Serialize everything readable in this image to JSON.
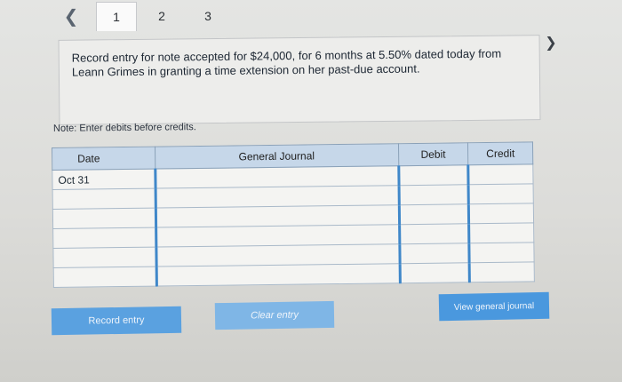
{
  "navigation": {
    "back_icon": "chevron-left-icon",
    "tabs": [
      {
        "label": "1",
        "active": true
      },
      {
        "label": "2",
        "active": false
      },
      {
        "label": "3",
        "active": false
      }
    ],
    "next_icon": "chevron-right-icon"
  },
  "prompt": {
    "text": "Record entry for note accepted for $24,000, for 6 months at 5.50% dated today from Leann Grimes in granting a time extension on her past-due account."
  },
  "note": "Note: Enter debits before credits.",
  "journal": {
    "headers": {
      "date": "Date",
      "general_journal": "General Journal",
      "debit": "Debit",
      "credit": "Credit"
    },
    "rows": [
      {
        "date": "Oct 31",
        "account": "",
        "debit": "",
        "credit": ""
      },
      {
        "date": "",
        "account": "",
        "debit": "",
        "credit": ""
      },
      {
        "date": "",
        "account": "",
        "debit": "",
        "credit": ""
      },
      {
        "date": "",
        "account": "",
        "debit": "",
        "credit": ""
      },
      {
        "date": "",
        "account": "",
        "debit": "",
        "credit": ""
      },
      {
        "date": "",
        "account": "",
        "debit": "",
        "credit": ""
      }
    ]
  },
  "buttons": {
    "record": "Record entry",
    "clear": "Clear entry",
    "view": "View general journal"
  },
  "colors": {
    "header_bg": "#c6d7e9",
    "button_blue": "#4a98de",
    "input_accent": "#3f87c9"
  }
}
